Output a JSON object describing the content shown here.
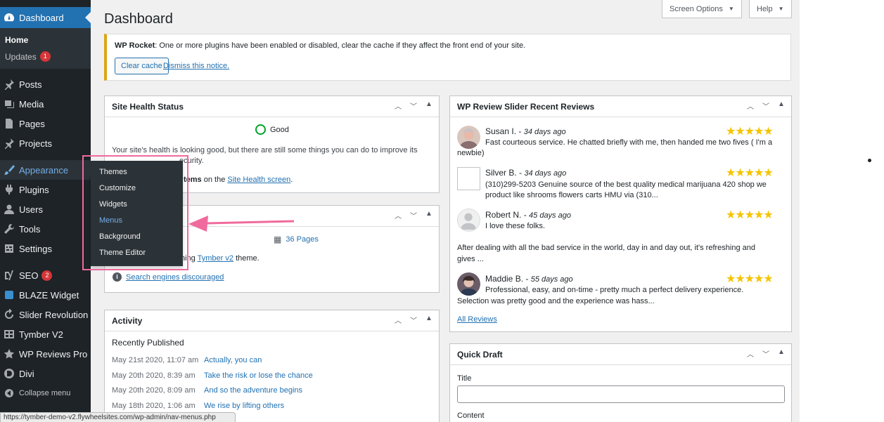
{
  "sidebar": {
    "dashboard": "Dashboard",
    "home": "Home",
    "updates": "Updates",
    "updates_count": "1",
    "items": [
      {
        "label": "Posts",
        "icon": "pin-icon"
      },
      {
        "label": "Media",
        "icon": "media-icon"
      },
      {
        "label": "Pages",
        "icon": "page-icon"
      },
      {
        "label": "Projects",
        "icon": "pin-icon"
      },
      {
        "label": "Appearance",
        "icon": "brush-icon"
      },
      {
        "label": "Plugins",
        "icon": "plug-icon"
      },
      {
        "label": "Users",
        "icon": "user-icon"
      },
      {
        "label": "Tools",
        "icon": "wrench-icon"
      },
      {
        "label": "Settings",
        "icon": "settings-icon"
      },
      {
        "label": "SEO",
        "icon": "yoast-icon"
      },
      {
        "label": "BLAZE Widget",
        "icon": "widget-icon"
      },
      {
        "label": "Slider Revolution",
        "icon": "refresh-icon"
      },
      {
        "label": "Tymber V2",
        "icon": "grid-icon"
      },
      {
        "label": "WP Reviews Pro",
        "icon": "star-icon"
      },
      {
        "label": "Divi",
        "icon": "divi-icon"
      }
    ],
    "seo_count": "2",
    "collapse": "Collapse menu"
  },
  "flyout": [
    "Themes",
    "Customize",
    "Widgets",
    "Menus",
    "Background",
    "Theme Editor"
  ],
  "header": {
    "title": "Dashboard",
    "screen_options": "Screen Options",
    "help": "Help"
  },
  "notice": {
    "brand": "WP Rocket",
    "text": ": One or more plugins have been enabled or disabled, clear the cache if they affect the front end of your site.",
    "clear_cache": "Clear cache",
    "dismiss": "Dismiss this notice."
  },
  "site_health": {
    "title": "Site Health Status",
    "status": "Good",
    "line1": "Your site's health is looking good, but there are still some things you can do to improve its",
    "line2_tail": "ecurity.",
    "items_tail": "tems",
    "on_the": " on the ",
    "link": "Site Health screen",
    "period": "."
  },
  "glance": {
    "pages": "36 Pages",
    "running_tail": "ning ",
    "theme_link": "Tymber v2",
    "theme_tail": " theme.",
    "search_disc": "Search engines discouraged"
  },
  "activity": {
    "title": "Activity",
    "recent": "Recently Published",
    "rows": [
      {
        "date": "May 21st 2020, 11:07 am",
        "title": "Actually, you can"
      },
      {
        "date": "May 20th 2020, 8:39 am",
        "title": "Take the risk or lose the chance"
      },
      {
        "date": "May 20th 2020, 8:09 am",
        "title": "And so the adventure begins"
      },
      {
        "date": "May 18th 2020, 1:06 am",
        "title": "We rise by lifting others"
      }
    ]
  },
  "reviews": {
    "title": "WP Review Slider Recent Reviews",
    "items": [
      {
        "name": "Susan I.",
        "ago": "34 days ago",
        "text1": "Fast courteous service. He chatted briefly with me, then handed me two fives ( I'm a",
        "text2": "newbie)"
      },
      {
        "name": "Silver B.",
        "ago": "34 days ago",
        "text1": "(310)299-5203 Genuine source of the best quality medical marijuana 420 shop we",
        "text2": "product like shrooms flowers carts HMU via (310..."
      },
      {
        "name": "Robert N.",
        "ago": "45 days ago",
        "text1": "I love these folks.",
        "text2": ""
      },
      {
        "name": "Maddie B.",
        "ago": "55 days ago",
        "text1": "Professional, easy, and on-time - pretty much a perfect delivery experience.",
        "text2": "Selection was pretty good and the experience was hass..."
      }
    ],
    "extra1": "After dealing with all the bad service in the world, day in and day out, it's refreshing and",
    "extra2": "gives ...",
    "all": "All Reviews",
    "sep": " - ",
    "stars": "★★★★★"
  },
  "quick_draft": {
    "title": "Quick Draft",
    "title_label": "Title",
    "content_label": "Content"
  },
  "statusbar": "https://tymber-demo-v2.flywheelsites.com/wp-admin/nav-menus.php",
  "colors": {
    "accent": "#2271b1",
    "sidebar": "#1d2327",
    "highlight": "#f06a9d",
    "star": "#f5c400"
  }
}
